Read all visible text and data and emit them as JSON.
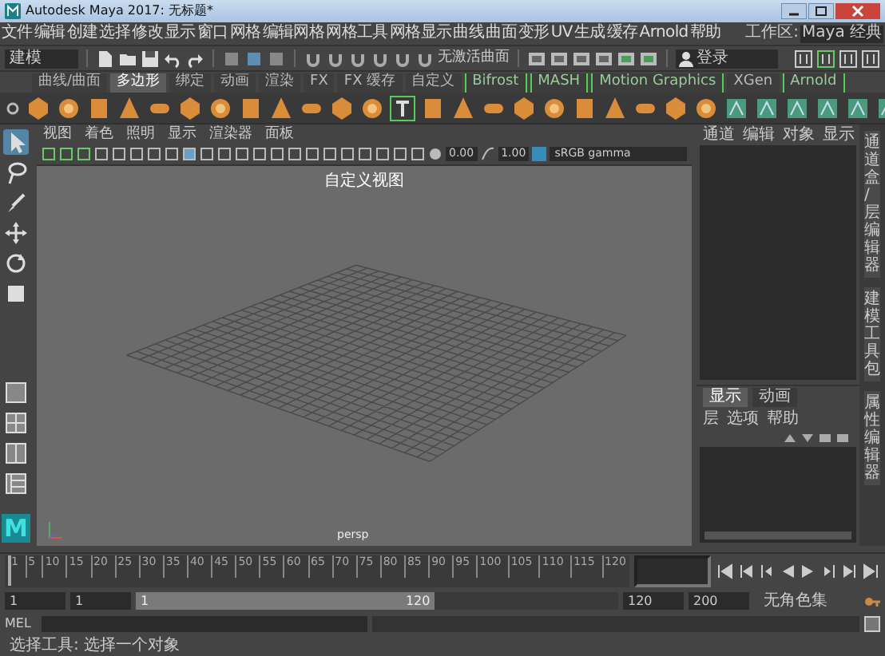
{
  "window": {
    "title": "Autodesk Maya 2017: 无标题*"
  },
  "menu_bar": [
    "文件",
    "编辑",
    "创建",
    "选择",
    "修改",
    "显示",
    "窗口",
    "网格",
    "编辑网格",
    "网格工具",
    "网格显示",
    "曲线",
    "曲面",
    "变形",
    "UV",
    "生成",
    "缓存",
    "Arnold",
    "帮助"
  ],
  "workspace": {
    "label": "工作区:",
    "value": "Maya 经典"
  },
  "status_line": {
    "mode": "建模",
    "snap_label": "无激活曲面",
    "user": "登录"
  },
  "shelf": {
    "tabs": [
      {
        "label": "曲线/曲面",
        "selected": false,
        "kind": "builtin"
      },
      {
        "label": "多边形",
        "selected": true,
        "kind": "builtin"
      },
      {
        "label": "绑定",
        "selected": false,
        "kind": "builtin"
      },
      {
        "label": "动画",
        "selected": false,
        "kind": "builtin"
      },
      {
        "label": "渲染",
        "selected": false,
        "kind": "builtin"
      },
      {
        "label": "FX",
        "selected": false,
        "kind": "builtin"
      },
      {
        "label": "FX 缓存",
        "selected": false,
        "kind": "builtin"
      },
      {
        "label": "自定义",
        "selected": false,
        "kind": "builtin"
      },
      {
        "label": "Bifrost",
        "selected": false,
        "kind": "plugin"
      },
      {
        "label": "MASH",
        "selected": false,
        "kind": "plugin"
      },
      {
        "label": "Motion Graphics",
        "selected": false,
        "kind": "plugin"
      },
      {
        "label": "XGen",
        "selected": false,
        "kind": "builtin"
      },
      {
        "label": "Arnold",
        "selected": false,
        "kind": "plugin"
      }
    ]
  },
  "tools": [
    {
      "kind": "select",
      "selected": true
    },
    {
      "kind": "lasso",
      "selected": false
    },
    {
      "kind": "paint",
      "selected": false
    },
    {
      "kind": "move",
      "selected": false
    },
    {
      "kind": "rotate",
      "selected": false
    },
    {
      "kind": "scale",
      "selected": false
    },
    {
      "kind": "single-view",
      "selected": false
    },
    {
      "kind": "four-view",
      "selected": false
    },
    {
      "kind": "two-view",
      "selected": false
    },
    {
      "kind": "outliner-view",
      "selected": false
    }
  ],
  "viewport": {
    "menu": [
      "视图",
      "着色",
      "照明",
      "显示",
      "渲染器",
      "面板"
    ],
    "exposure": "0.00",
    "gamma": "1.00",
    "color_space": "sRGB gamma",
    "title": "自定义视图",
    "camera": "persp"
  },
  "logo": "M",
  "channel_box": {
    "menu": [
      "通道",
      "编辑",
      "对象",
      "显示"
    ]
  },
  "side_tabs": [
    "通道盒/层编辑器",
    "建模工具包",
    "属性编辑器"
  ],
  "layer_editor": {
    "tabs": [
      {
        "label": "显示",
        "selected": true
      },
      {
        "label": "动画",
        "selected": false
      }
    ],
    "menu": [
      "层",
      "选项",
      "帮助"
    ]
  },
  "timeline": {
    "level": 0,
    "ticks": [
      "1",
      "5",
      "10",
      "15",
      "20",
      "25",
      "30",
      "35",
      "40",
      "45",
      "50",
      "55",
      "60",
      "65",
      "70",
      "75",
      "80",
      "85",
      "90",
      "95",
      "100",
      "105",
      "110",
      "115",
      "120"
    ]
  },
  "range": {
    "start": "1",
    "playback_start": "1",
    "slider_start": "1",
    "slider_end": "120",
    "level": 0.62,
    "playback_end": "120",
    "end": "200",
    "character_set": "无角色集"
  },
  "command_line": {
    "label": "MEL"
  },
  "help_line": "选择工具: 选择一个对象"
}
